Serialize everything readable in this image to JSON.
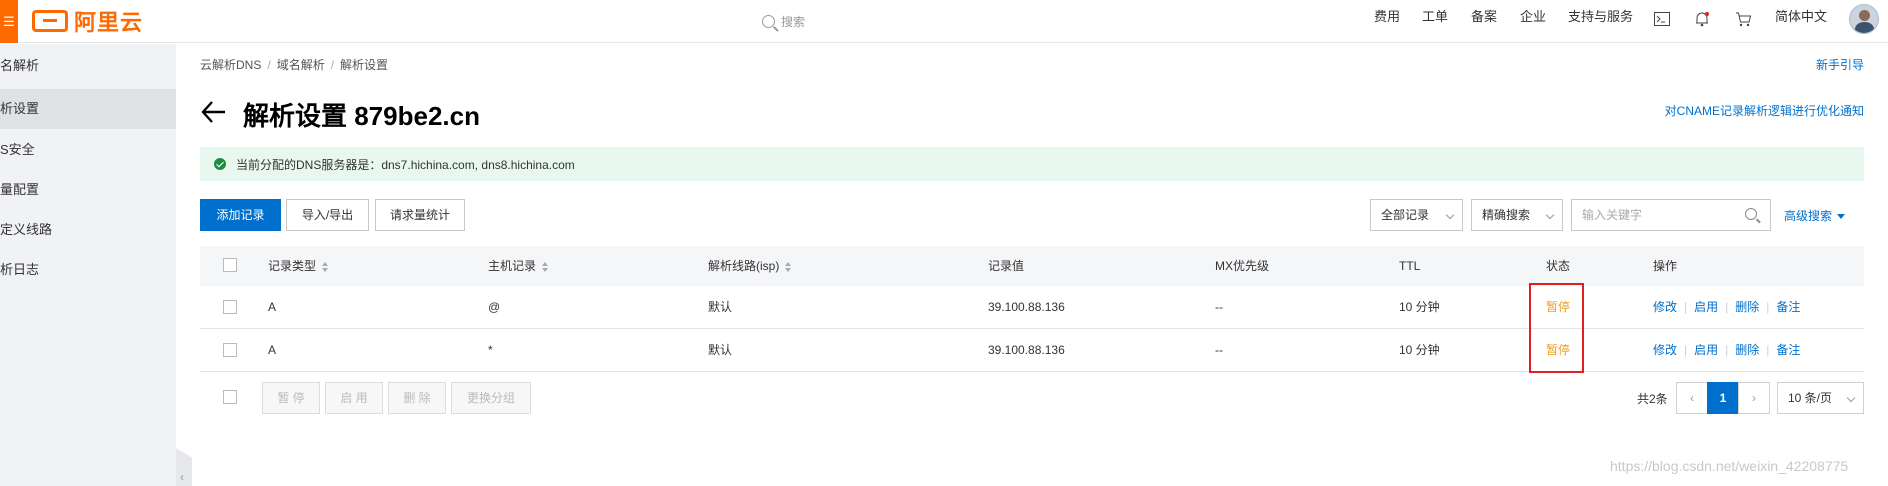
{
  "topbar": {
    "logo_text": "阿里云",
    "search_placeholder": "搜索",
    "nav": [
      "费用",
      "工单",
      "备案",
      "企业",
      "支持与服务"
    ],
    "language": "简体中文"
  },
  "sidebar": {
    "items": [
      {
        "label": "名解析",
        "active": false
      },
      {
        "label": "析设置",
        "active": true
      },
      {
        "label": "S安全",
        "active": false
      },
      {
        "label": "量配置",
        "active": false
      },
      {
        "label": "定义线路",
        "active": false
      },
      {
        "label": "析日志",
        "active": false
      }
    ]
  },
  "breadcrumb": [
    "云解析DNS",
    "域名解析",
    "解析设置"
  ],
  "guide_link": "新手引导",
  "page_title": "解析设置 879be2.cn",
  "notice_link": "对CNAME记录解析逻辑进行优化通知",
  "alert_text": "当前分配的DNS服务器是：dns7.hichina.com, dns8.hichina.com",
  "toolbar": {
    "add_record": "添加记录",
    "import_export": "导入/导出",
    "request_stats": "请求量统计",
    "filter_all": "全部记录",
    "precise_search": "精确搜索",
    "keyword_placeholder": "输入关键字",
    "advanced_search": "高级搜索"
  },
  "table": {
    "headers": {
      "type": "记录类型",
      "host": "主机记录",
      "line": "解析线路(isp)",
      "value": "记录值",
      "mx": "MX优先级",
      "ttl": "TTL",
      "status": "状态",
      "ops": "操作"
    },
    "rows": [
      {
        "type": "A",
        "host": "@",
        "line": "默认",
        "value": "39.100.88.136",
        "mx": "--",
        "ttl": "10 分钟",
        "status": "暂停"
      },
      {
        "type": "A",
        "host": "*",
        "line": "默认",
        "value": "39.100.88.136",
        "mx": "--",
        "ttl": "10 分钟",
        "status": "暂停"
      }
    ],
    "ops": [
      "修改",
      "启用",
      "删除",
      "备注"
    ]
  },
  "bulk": {
    "pause": "暂 停",
    "enable": "启 用",
    "delete": "删 除",
    "change_group": "更换分组"
  },
  "pagination": {
    "total": "共2条",
    "current": "1",
    "page_size": "10 条/页"
  },
  "watermark": "https://blog.csdn.net/weixin_42208775",
  "colors": {
    "brand": "#ff6a00",
    "primary": "#0070cc",
    "paused": "#f0a020",
    "highlight": "#e02020"
  }
}
